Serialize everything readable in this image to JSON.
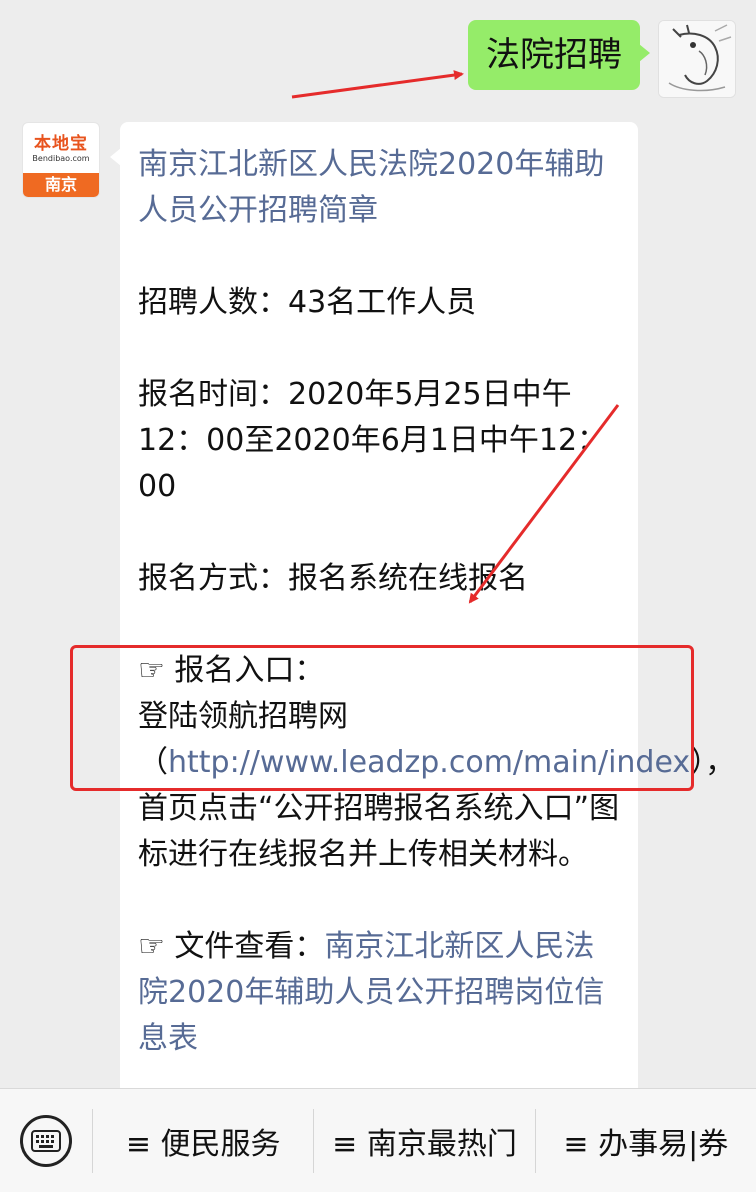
{
  "outgoing": {
    "text": "法院招聘"
  },
  "avatar_bot": {
    "brand": "本地宝",
    "domain": "Bendibao.com",
    "city": "南京"
  },
  "incoming": {
    "title_link": "南京江北新区人民法院2020年辅助人员公开招聘简章",
    "count_line": "招聘人数：43名工作人员",
    "time_line": "报名时间：2020年5月25日中午12：00至2020年6月1日中午12：00",
    "method_line": "报名方式：报名系统在线报名",
    "entry": {
      "label": "☞ 报名入口：",
      "prefix": "登陆领航招聘网（",
      "link": "http://www.leadzp.com/main/index",
      "suffix": "），首页点击“公开招聘报名系统入口”图标进行在线报名并上传相关材料。"
    },
    "docs": {
      "label": "☞ 文件查看：",
      "link": "南京江北新区人民法院2020年辅助人员公开招聘岗位信息表"
    }
  },
  "bottom_menu": {
    "items": [
      "≡ 便民服务",
      "≡ 南京最热门",
      "≡ 办事易|券"
    ]
  },
  "colors": {
    "background": "#ededed",
    "outgoing_bubble": "#95ec69",
    "link": "#576b95",
    "annotation_red": "#e52b2b",
    "brand_orange": "#ef6a22"
  }
}
